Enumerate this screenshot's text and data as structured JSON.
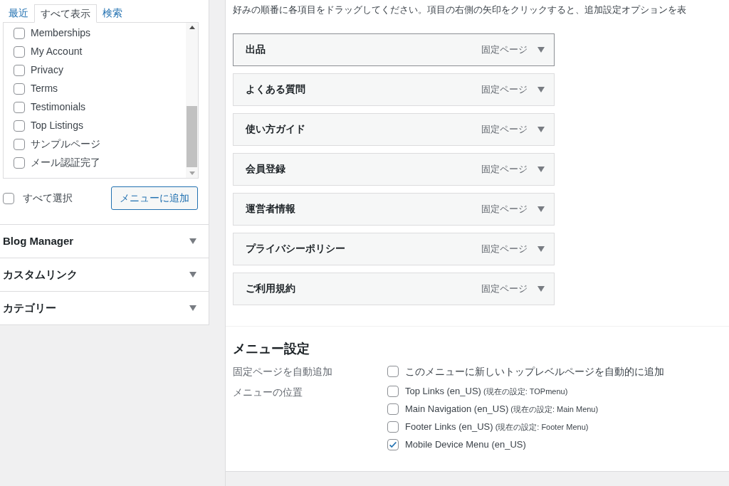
{
  "sidebar": {
    "tabs": [
      {
        "label": "最近",
        "selected": false
      },
      {
        "label": "すべて表示",
        "selected": true
      },
      {
        "label": "検索",
        "selected": false
      }
    ],
    "pages": [
      {
        "label": "Memberships",
        "checked": false
      },
      {
        "label": "My Account",
        "checked": false
      },
      {
        "label": "Privacy",
        "checked": false
      },
      {
        "label": "Terms",
        "checked": false
      },
      {
        "label": "Testimonials",
        "checked": false
      },
      {
        "label": "Top Listings",
        "checked": false
      },
      {
        "label": "サンプルページ",
        "checked": false
      },
      {
        "label": "メール認証完了",
        "checked": false
      }
    ],
    "select_all": {
      "label": "すべて選択",
      "checked": false
    },
    "add_button": "メニューに追加",
    "sections": [
      {
        "title": "Blog Manager",
        "expanded": false
      },
      {
        "title": "カスタムリンク",
        "expanded": false
      },
      {
        "title": "カテゴリー",
        "expanded": false
      }
    ]
  },
  "structure": {
    "instructions": "好みの順番に各項目をドラッグしてください。項目の右側の矢印をクリックすると、追加設定オプションを表",
    "items": [
      {
        "title": "出品",
        "type": "固定ページ",
        "selected": true
      },
      {
        "title": "よくある質問",
        "type": "固定ページ",
        "selected": false
      },
      {
        "title": "使い方ガイド",
        "type": "固定ページ",
        "selected": false
      },
      {
        "title": "会員登録",
        "type": "固定ページ",
        "selected": false
      },
      {
        "title": "運営者情報",
        "type": "固定ページ",
        "selected": false
      },
      {
        "title": "プライバシーポリシー",
        "type": "固定ページ",
        "selected": false
      },
      {
        "title": "ご利用規約",
        "type": "固定ページ",
        "selected": false
      }
    ]
  },
  "menu_settings": {
    "heading": "メニュー設定",
    "auto_add": {
      "label": "固定ページを自動追加",
      "option": "このメニューに新しいトップレベルページを自動的に追加",
      "checked": false
    },
    "locations": {
      "label": "メニューの位置",
      "options": [
        {
          "name": "Top Links (en_US)",
          "current": "(現在の設定: TOPmenu)",
          "checked": false
        },
        {
          "name": "Main Navigation (en_US)",
          "current": "(現在の設定: Main Menu)",
          "checked": false
        },
        {
          "name": "Footer Links (en_US)",
          "current": "(現在の設定: Footer Menu)",
          "checked": false
        },
        {
          "name": "Mobile Device Menu (en_US)",
          "checked": true
        }
      ]
    }
  }
}
